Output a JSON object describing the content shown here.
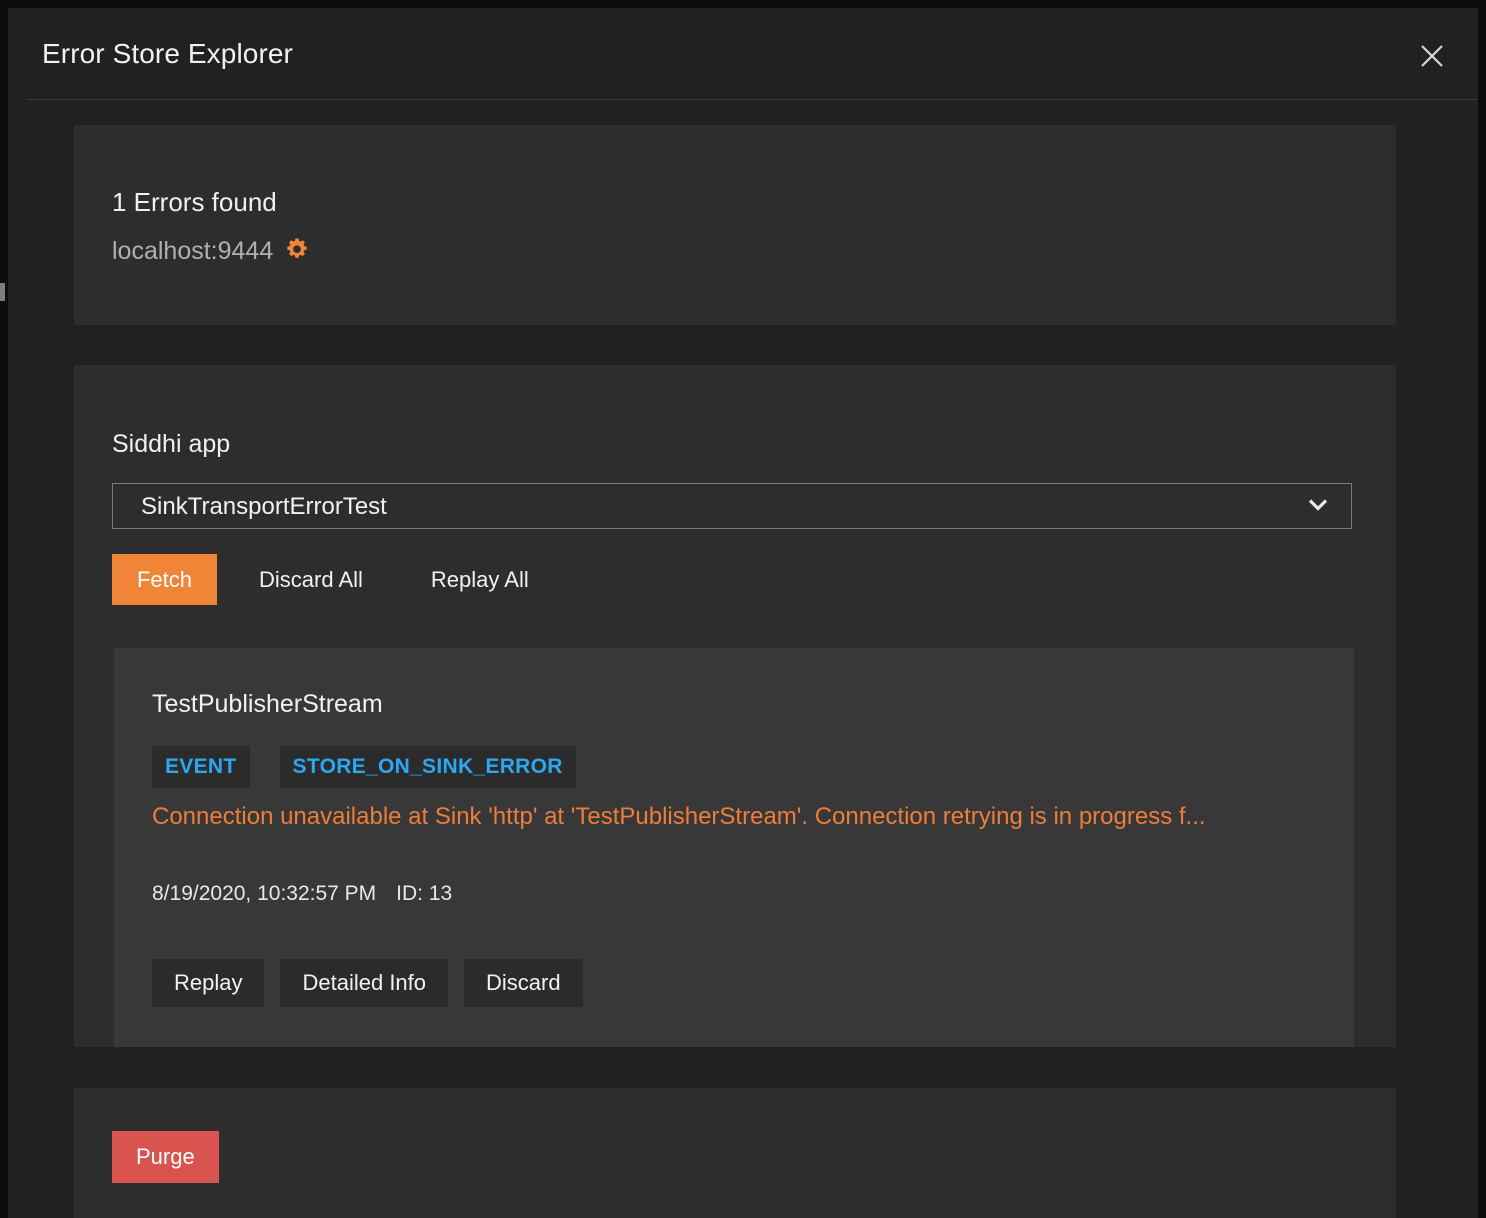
{
  "modal": {
    "title": "Error Store Explorer",
    "close_icon": "close-icon"
  },
  "summary": {
    "errors_found": "1 Errors found",
    "host": "localhost:9444",
    "settings_icon": "gear-icon"
  },
  "main": {
    "field_label": "Siddhi app",
    "select": {
      "value": "SinkTransportErrorTest",
      "options": [
        "SinkTransportErrorTest"
      ],
      "chevron_icon": "chevron-down-icon"
    },
    "actions": {
      "fetch": "Fetch",
      "discard_all": "Discard All",
      "replay_all": "Replay All"
    },
    "error_card": {
      "stream_name": "TestPublisherStream",
      "badges": [
        "EVENT",
        "STORE_ON_SINK_ERROR"
      ],
      "message": "Connection unavailable at Sink 'http' at 'TestPublisherStream'. Connection retrying is in progress f...",
      "timestamp": "8/19/2020, 10:32:57 PM",
      "id": "ID: 13",
      "buttons": {
        "replay": "Replay",
        "detailed_info": "Detailed Info",
        "discard": "Discard"
      }
    }
  },
  "purge": {
    "label": "Purge"
  },
  "colors": {
    "accent_orange": "#f08537",
    "error_orange": "#ee7d3a",
    "badge_blue": "#2aa8f2",
    "danger_red": "#d9534f",
    "panel_bg": "#2d2d2d",
    "card_bg": "#383838",
    "modal_bg": "#212121"
  }
}
